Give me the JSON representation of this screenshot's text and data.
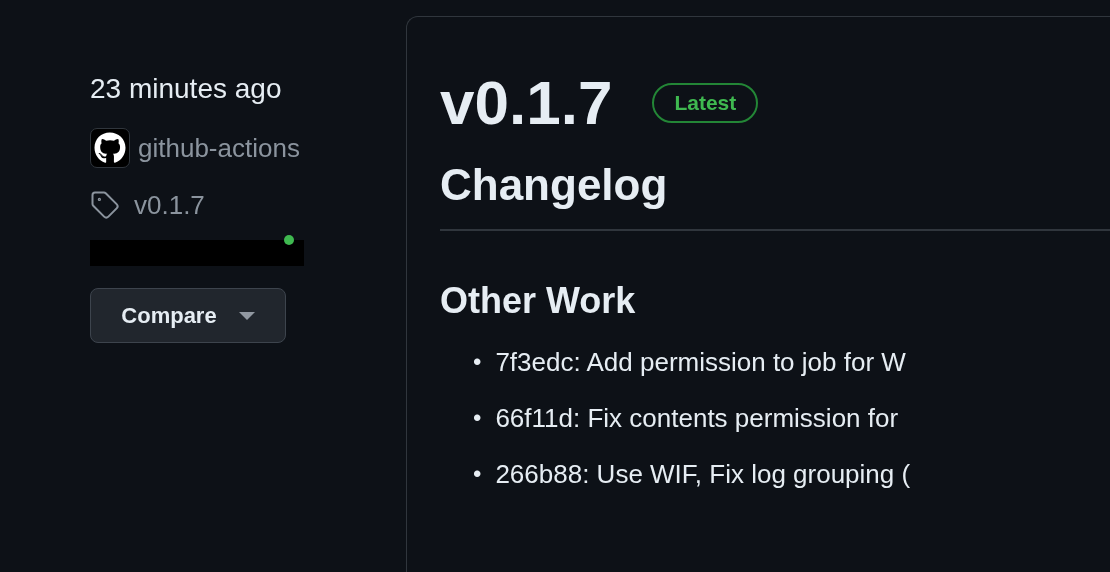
{
  "sidebar": {
    "time": "23 minutes ago",
    "author": "github-actions",
    "tag": "v0.1.7",
    "compare_button": "Compare"
  },
  "release": {
    "title": "v0.1.7",
    "badge": "Latest",
    "heading": "Changelog",
    "section": "Other Work",
    "items": [
      {
        "bullet": "•",
        "text": "7f3edc: Add permission to job for W"
      },
      {
        "bullet": "•",
        "text": "66f11d: Fix contents permission for"
      },
      {
        "bullet": "•",
        "text": "266b88: Use WIF, Fix log grouping ("
      }
    ]
  }
}
